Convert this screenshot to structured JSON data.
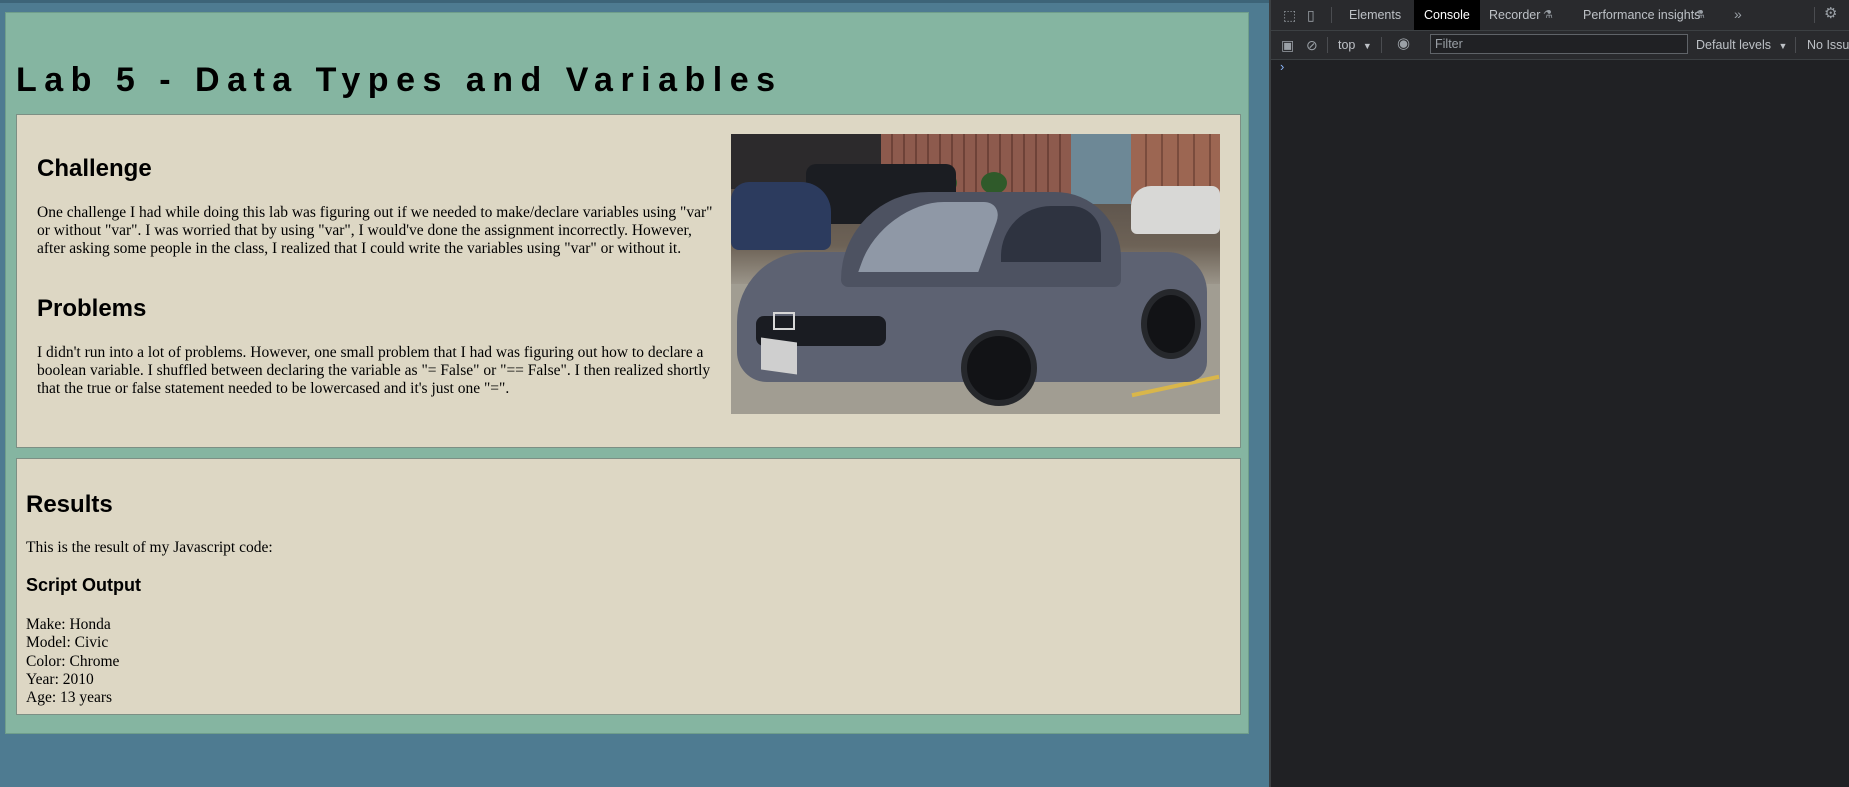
{
  "page": {
    "title": "Lab 5 - Data Types and Variables",
    "challenge": {
      "heading": "Challenge",
      "text": "One challenge I had while doing this lab was figuring out if we needed to make/declare variables using \"var\" or without \"var\". I was worried that by using \"var\", I would've done the assignment incorrectly. However, after asking some people in the class, I realized that I could write the variables using \"var\" or without it."
    },
    "problems": {
      "heading": "Problems",
      "text": "I didn't run into a lot of problems. However, one small problem that I had was figuring out how to declare a boolean variable. I shuffled between declaring the variable as \"= False\" or \"== False\". I then realized shortly that the true or false statement needed to be lowercased and it's just one \"=\"."
    },
    "results": {
      "heading": "Results",
      "text": "This is the result of my Javascript code:",
      "script_output_heading": "Script Output",
      "lines": [
        "Make: Honda",
        "Model: Civic",
        "Color: Chrome",
        "Year: 2010",
        "Age: 13 years"
      ]
    }
  },
  "devtools": {
    "tabs": [
      "Elements",
      "Console",
      "Recorder",
      "Performance insights"
    ],
    "active_tab": "Console",
    "context": "top",
    "filter_placeholder": "Filter",
    "levels": "Default levels",
    "issues": "No Issues",
    "prompt": "›"
  },
  "colors": {
    "page_background": "#4e7b91",
    "wrapper_background": "#85b5a1",
    "panel_background": "#ddd7c4",
    "devtools_background": "#202124"
  }
}
